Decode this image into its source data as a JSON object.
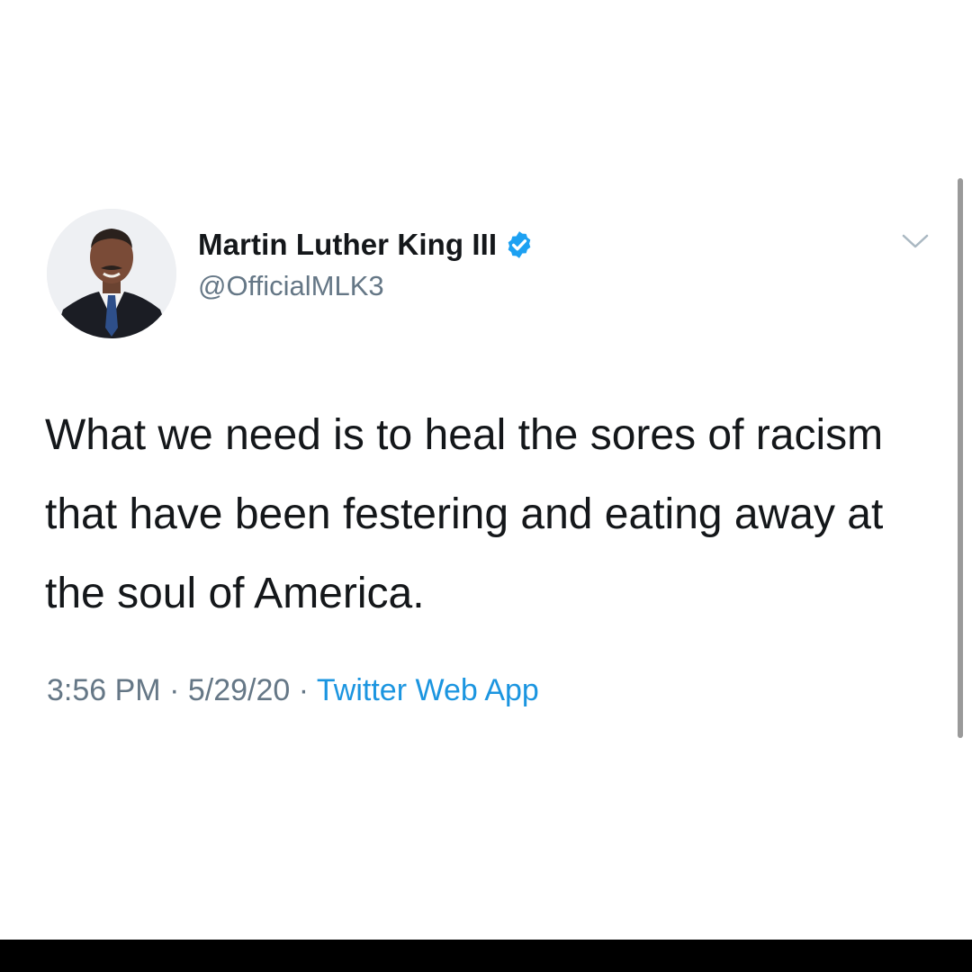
{
  "tweet": {
    "author": {
      "display_name": "Martin Luther King III",
      "handle": "@OfficialMLK3",
      "verified": true,
      "avatar": "profile-photo"
    },
    "menu_icon": "chevron-down-icon",
    "text": "What we need is to heal the sores of racism that have been festering and eating away at the soul of America.",
    "meta": {
      "time": "3:56 PM",
      "separator": " · ",
      "date": "5/29/20",
      "source": "Twitter Web App"
    }
  },
  "colors": {
    "text_primary": "#14171a",
    "text_secondary": "#657786",
    "link": "#1b95e0",
    "verified": "#1da1f2",
    "background": "#ffffff",
    "bottom_bar": "#000000"
  }
}
